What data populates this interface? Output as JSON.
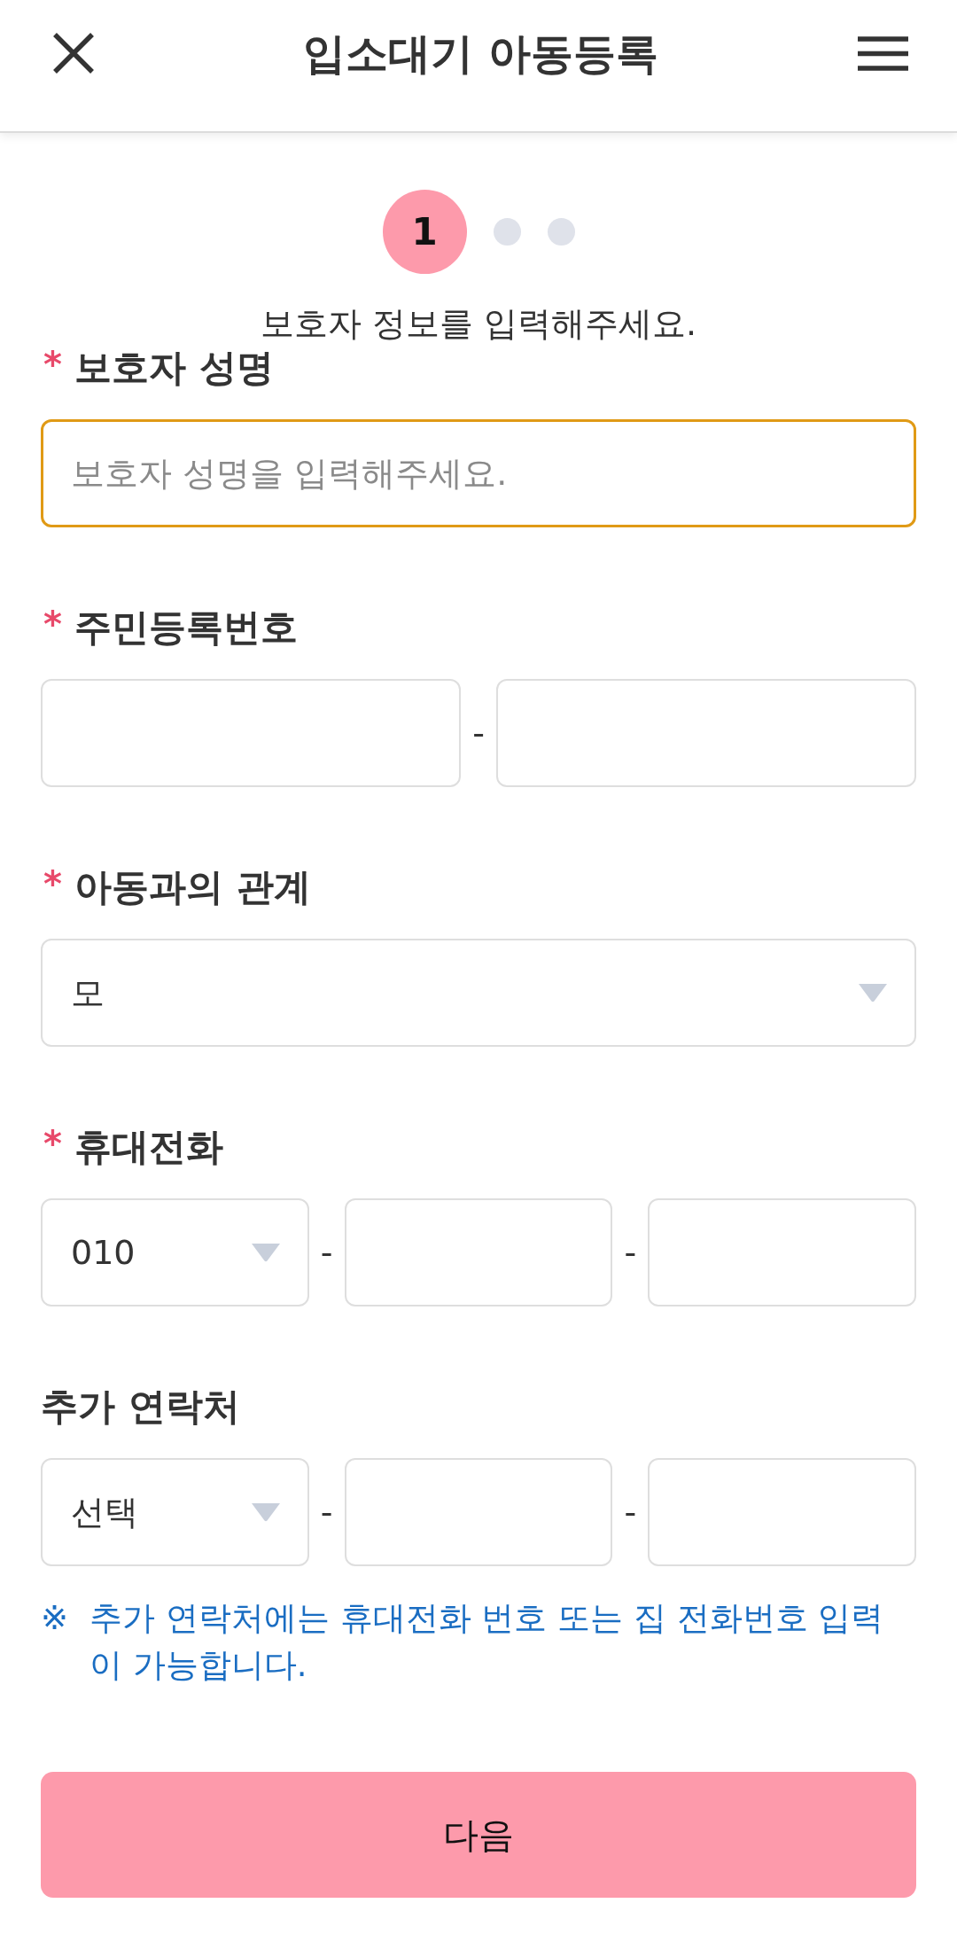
{
  "header": {
    "title": "입소대기 아동등록"
  },
  "stepper": {
    "steps": [
      {
        "label": "1",
        "selected": true
      },
      {
        "selected": false
      },
      {
        "selected": false
      }
    ]
  },
  "subtitle": "보호자 정보를 입력해주세요.",
  "fields": [
    {
      "required_mark": "*",
      "label": "보호자 성명",
      "items": [
        {
          "kind": "input",
          "placeholder": "보호자 성명을 입력해주세요.",
          "focused": true
        }
      ]
    },
    {
      "required_mark": "*",
      "label": "주민등록번호",
      "items": [
        {
          "kind": "input",
          "focused": false
        },
        {
          "kind": "separator",
          "text": "-"
        },
        {
          "kind": "input",
          "focused": false
        }
      ]
    },
    {
      "required_mark": "*",
      "label": "아동과의 관계",
      "items": [
        {
          "kind": "select",
          "value": "모",
          "focused": false
        }
      ]
    },
    {
      "required_mark": "*",
      "label": "휴대전화",
      "items": [
        {
          "kind": "select",
          "value": "010",
          "focused": false
        },
        {
          "kind": "separator",
          "text": "-"
        },
        {
          "kind": "input",
          "focused": false
        },
        {
          "kind": "separator",
          "text": "-"
        },
        {
          "kind": "input",
          "focused": false
        }
      ]
    },
    {
      "label": "추가 연락처",
      "items": [
        {
          "kind": "select",
          "value": "선택",
          "focused": false
        },
        {
          "kind": "separator",
          "text": "-"
        },
        {
          "kind": "input",
          "focused": false
        },
        {
          "kind": "separator",
          "text": "-"
        },
        {
          "kind": "input",
          "focused": false
        }
      ]
    }
  ],
  "note": {
    "mark": "※",
    "text": "추가 연락처에는 휴대전화 번호 또는 집 전화번호 입력이 가능합니다."
  },
  "next_button": "다음"
}
